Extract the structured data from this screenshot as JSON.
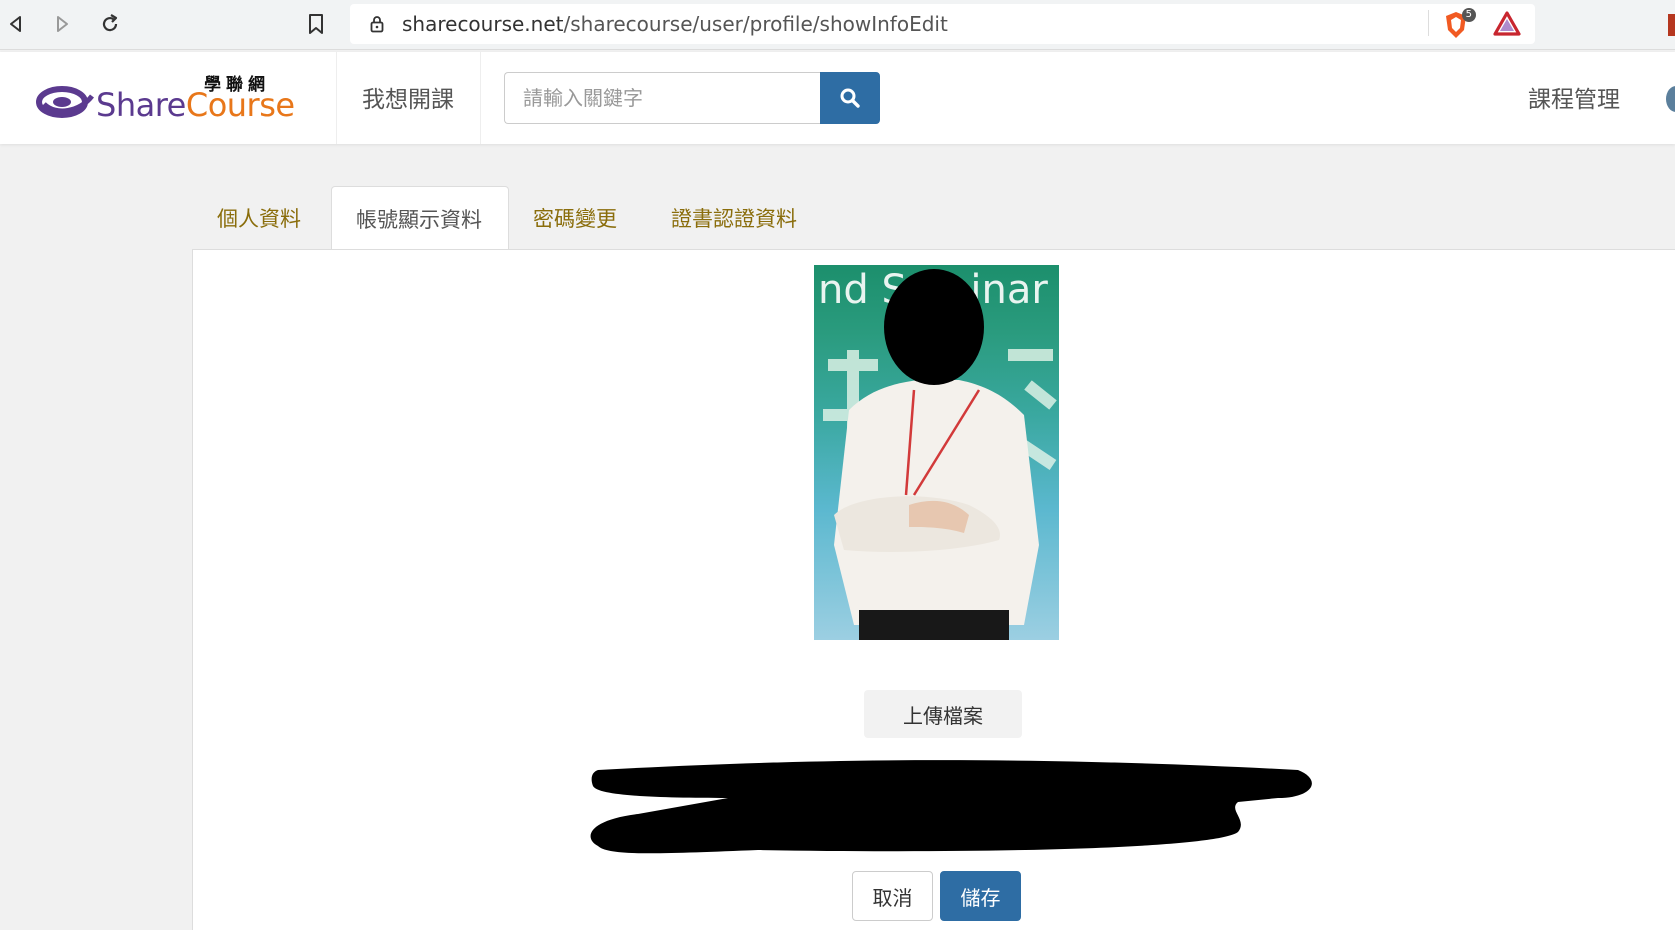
{
  "browser": {
    "url_host": "sharecourse.net",
    "url_path": "/sharecourse/user/profile/showInfoEdit",
    "extension_badge": "5"
  },
  "header": {
    "logo_text_share": "Share",
    "logo_text_course": "Course",
    "logo_text_cn": "學聯網",
    "nav_open_course": "我想開課",
    "search_placeholder": "請輸入關鍵字",
    "nav_course_manage": "課程管理"
  },
  "tabs": [
    {
      "label": "個人資料",
      "active": false
    },
    {
      "label": "帳號顯示資料",
      "active": true
    },
    {
      "label": "密碼變更",
      "active": false
    },
    {
      "label": "證書認證資料",
      "active": false
    }
  ],
  "profile": {
    "photo_banner_text": "nd Seminar",
    "upload_label": "上傳檔案",
    "cancel_label": "取消",
    "save_label": "儲存"
  },
  "colors": {
    "primary": "#2e6da4",
    "tab_text": "#8a6d0b",
    "logo_purple": "#5b3a8f",
    "logo_orange": "#e8771a"
  }
}
